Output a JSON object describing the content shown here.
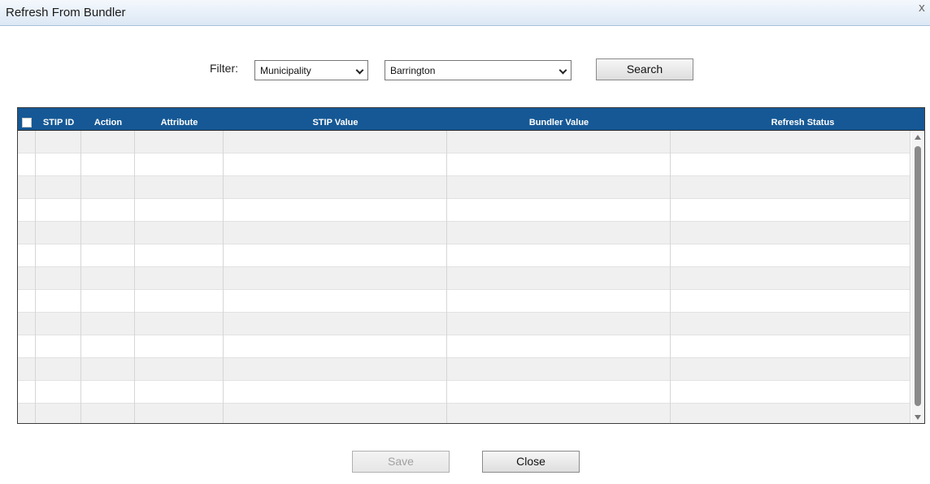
{
  "dialog": {
    "title": "Refresh From Bundler",
    "close_glyph": "x"
  },
  "filter": {
    "label": "Filter:",
    "type_selected": "Municipality",
    "value_selected": "Barrington",
    "search_label": "Search"
  },
  "grid": {
    "columns": [
      "STIP ID",
      "Action",
      "Attribute",
      "STIP Value",
      "Bundler Value",
      "Refresh Status"
    ],
    "select_all_checked": false,
    "rows": [],
    "colors": {
      "header_bg": "#155895",
      "header_text": "#ffffff",
      "row_alt": "#f0f0f0"
    }
  },
  "footer": {
    "save_label": "Save",
    "save_disabled": true,
    "close_label": "Close"
  }
}
